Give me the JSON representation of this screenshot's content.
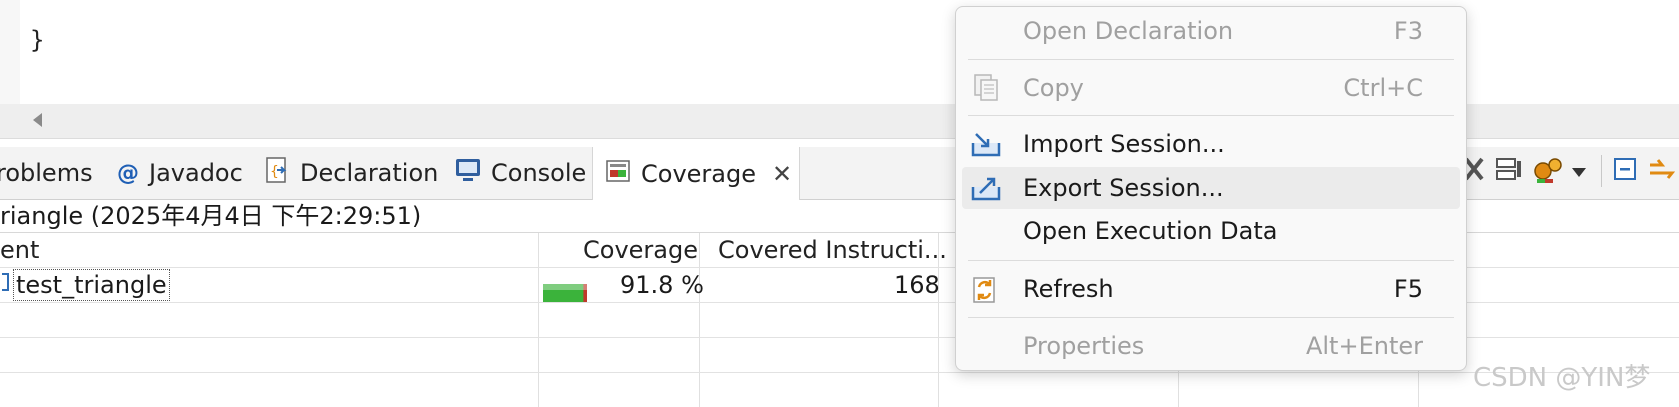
{
  "editor": {
    "closing_brace": "}"
  },
  "tabs": [
    {
      "label": "roblems"
    },
    {
      "label": "Javadoc"
    },
    {
      "label": "Declaration"
    },
    {
      "label": "Console"
    },
    {
      "label": "Coverage"
    }
  ],
  "coverage": {
    "session_label": "riangle (2025年4月4日 下午2:29:51)",
    "columns": [
      "ent",
      "Coverage",
      "Covered Instructi..."
    ],
    "rows": [
      {
        "element": "test_triangle",
        "coverage": "91.8 %",
        "coverage_fraction": 0.918,
        "covered_instructions": "168"
      }
    ]
  },
  "context_menu": {
    "items": [
      {
        "label": "Open Declaration",
        "shortcut": "F3",
        "enabled": false,
        "icon": ""
      },
      {
        "label": "Copy",
        "shortcut": "Ctrl+C",
        "enabled": false,
        "icon": "copy-icon"
      },
      {
        "label": "Import Session...",
        "shortcut": "",
        "enabled": true,
        "icon": "import-session-icon"
      },
      {
        "label": "Export Session...",
        "shortcut": "",
        "enabled": true,
        "icon": "export-session-icon",
        "highlighted": true
      },
      {
        "label": "Open Execution Data",
        "shortcut": "",
        "enabled": true,
        "icon": ""
      },
      {
        "label": "Refresh",
        "shortcut": "F5",
        "enabled": true,
        "icon": "refresh-icon"
      },
      {
        "label": "Properties",
        "shortcut": "Alt+Enter",
        "enabled": false,
        "icon": ""
      }
    ]
  },
  "watermark": "CSDN @YIN梦",
  "colors": {
    "coverage_bar": "#3bb33b",
    "coverage_miss": "#c0392b",
    "icon_blue": "#2f6db5",
    "icon_orange": "#e08a12"
  }
}
